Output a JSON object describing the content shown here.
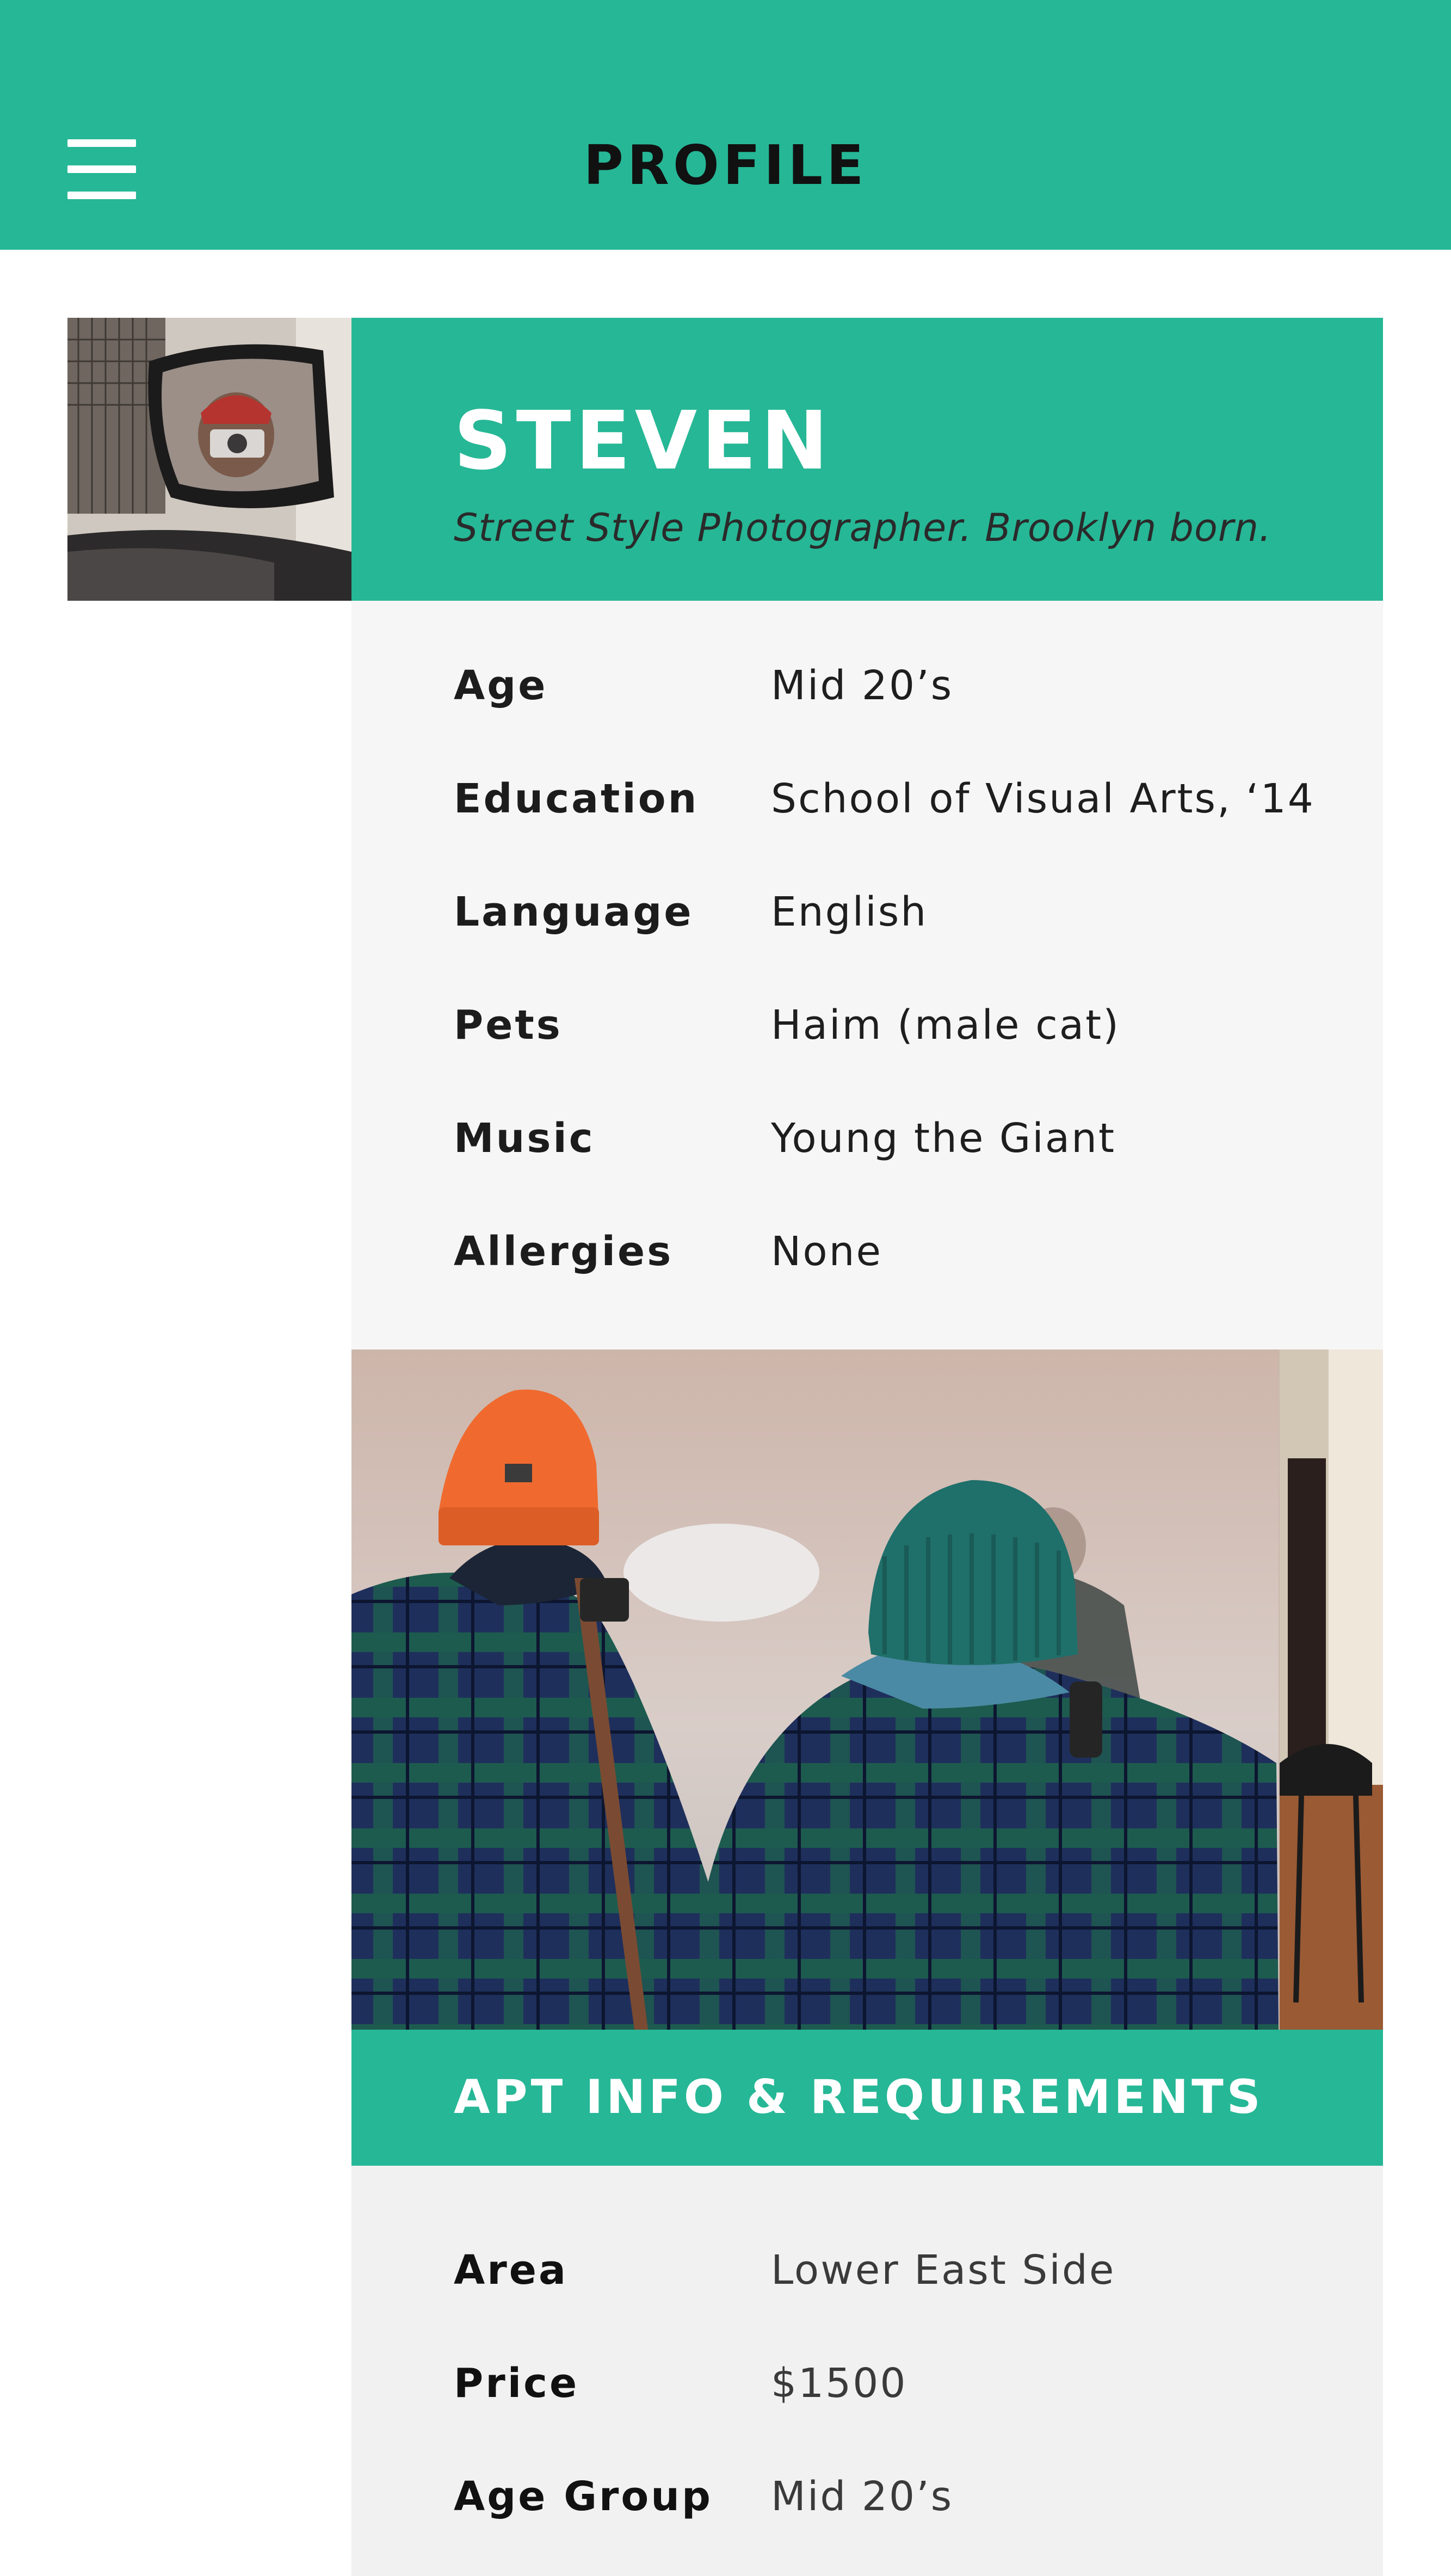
{
  "header": {
    "title": "PROFILE",
    "menu_icon": "hamburger-menu-icon",
    "background": "#26b796"
  },
  "profile": {
    "name": "STEVEN",
    "tagline": "Street Style Photographer. Brooklyn born.",
    "avatar": "photo of a person photographing themselves in a car side mirror",
    "details": [
      {
        "label": "Age",
        "value": "Mid 20’s"
      },
      {
        "label": "Education",
        "value": "School of Visual Arts, ‘14"
      },
      {
        "label": "Language",
        "value": "English"
      },
      {
        "label": "Pets",
        "value": "Haim (male cat)"
      },
      {
        "label": "Music",
        "value": "Young the Giant"
      },
      {
        "label": "Allergies",
        "value": "None"
      }
    ]
  },
  "gallery": {
    "current": "two photographers in beanies and plaid jackets",
    "next": "apartment interior with chair"
  },
  "apartment": {
    "section_title": "APT INFO & REQUIREMENTS",
    "details": [
      {
        "label": "Area",
        "value": "Lower East Side"
      },
      {
        "label": "Price",
        "value": "$1500"
      },
      {
        "label": "Age Group",
        "value": "Mid 20’s"
      }
    ]
  },
  "colors": {
    "accent": "#26b796",
    "panel": "#f6f6f6",
    "panel_alt": "#f1f1f1",
    "text": "#1e1e1e"
  }
}
